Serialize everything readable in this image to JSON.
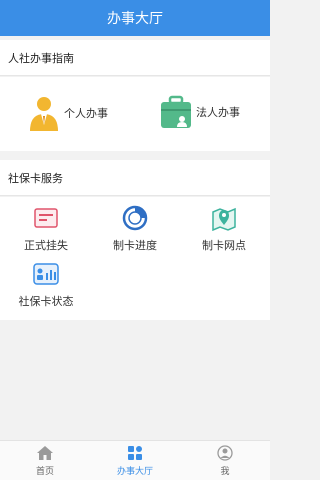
{
  "header": {
    "title": "办事大厅"
  },
  "guide": {
    "title": "人社办事指南",
    "items": [
      {
        "label": "个人办事",
        "icon": "person-icon"
      },
      {
        "label": "法人办事",
        "icon": "briefcase-icon"
      }
    ]
  },
  "card_service": {
    "title": "社保卡服务",
    "items": [
      {
        "label": "正式挂失",
        "icon": "report-loss-icon"
      },
      {
        "label": "制卡进度",
        "icon": "progress-icon"
      },
      {
        "label": "制卡网点",
        "icon": "map-pin-icon"
      },
      {
        "label": "社保卡状态",
        "icon": "card-status-icon"
      }
    ]
  },
  "tabbar": {
    "tabs": [
      {
        "label": "首页",
        "icon": "home-icon"
      },
      {
        "label": "办事大厅",
        "icon": "grid-icon",
        "active": true
      },
      {
        "label": "我",
        "icon": "user-icon"
      }
    ]
  },
  "colors": {
    "primary": "#3a8ee6",
    "gold": "#f2b630",
    "green": "#53b98a",
    "red": "#e0546b"
  }
}
